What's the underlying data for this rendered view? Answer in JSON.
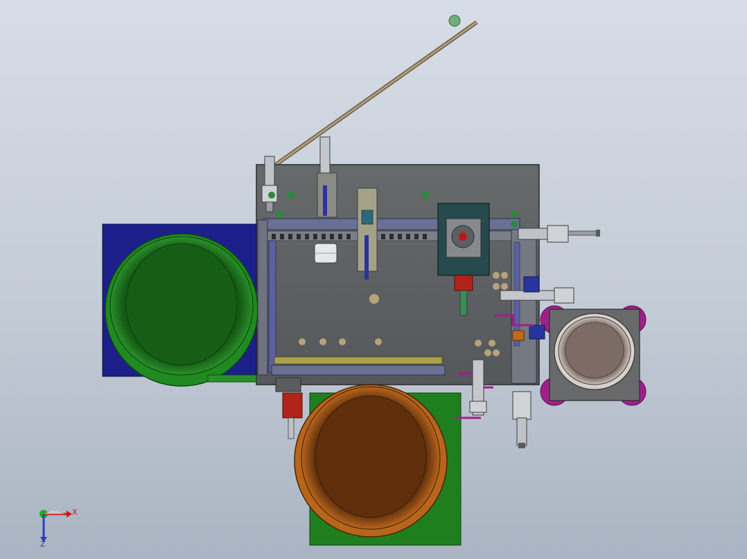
{
  "view": {
    "background_top": "#d7dde6",
    "background_bottom": "#aab4c2"
  },
  "triad": {
    "x_label": "X",
    "z_label": "Z",
    "x_color": "#d01818",
    "y_color": "#18b018",
    "z_color": "#2a3fc0"
  },
  "assembly": {
    "base_plate_color": "#5d5f60",
    "blue_plate_color": "#1c1f8a",
    "green_bowl_color": "#1b7a1b",
    "orange_bowl_color": "#a55415",
    "green_plate_color": "#1f7f1f",
    "grey_bowl_color": "#8c7a73",
    "purple_feet_color": "#a0208a",
    "teal_block_color": "#274a4e",
    "rail_color": "#6a6f94"
  }
}
